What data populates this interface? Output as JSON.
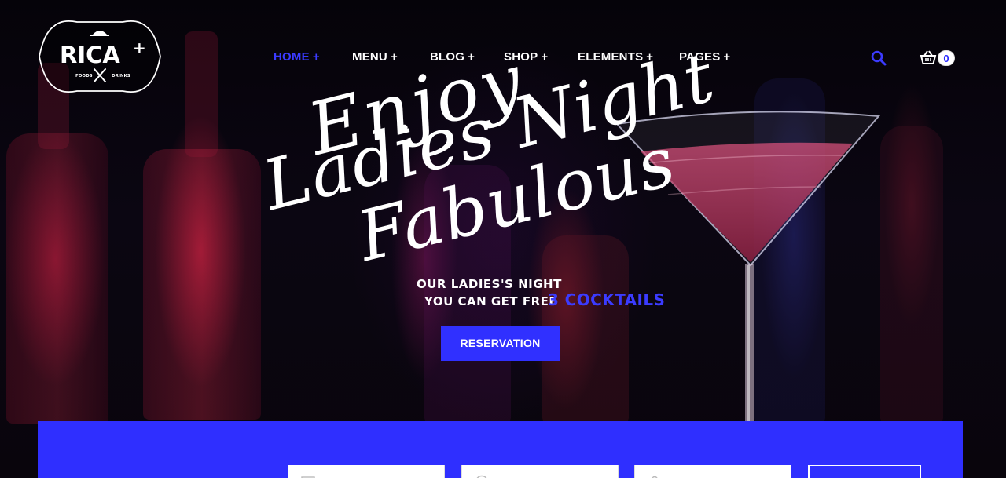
{
  "brand": {
    "name": "RICA",
    "plus": "+",
    "tagline_left": "FOODS",
    "tagline_right": "DRINKS"
  },
  "nav": {
    "items": [
      {
        "label": "HOME",
        "active": true
      },
      {
        "label": "MENU",
        "active": false
      },
      {
        "label": "BLOG",
        "active": false
      },
      {
        "label": "SHOP",
        "active": false
      },
      {
        "label": "ELEMENTS",
        "active": false
      },
      {
        "label": "PAGES",
        "active": false
      }
    ],
    "plus_glyph": "+"
  },
  "header_icons": {
    "search": "search-icon",
    "cart": "cart-icon",
    "cart_count": "0"
  },
  "hero": {
    "line1": "Enjoy",
    "line2": "Ladies Night",
    "line3": "Fabulous",
    "subline1": "OUR LADIES'S NIGHT",
    "subline2": "YOU CAN GET FREE",
    "highlight": "3 COCKTAILS",
    "cta": "RESERVATION"
  },
  "colors": {
    "accent": "#3030ff",
    "nav_active": "#3b3bff",
    "text": "#ffffff"
  }
}
